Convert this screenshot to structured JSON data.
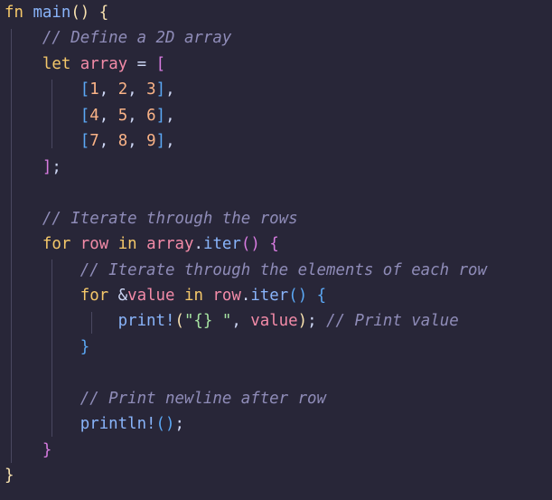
{
  "editor": {
    "theme_colors": {
      "background": "#282638",
      "keyword": "#f5c86a",
      "function": "#89b4fa",
      "variable": "#f38ba8",
      "comment": "#8f8cb8",
      "number": "#fab387",
      "string": "#a6e3a1"
    },
    "lines": [
      {
        "tokens": [
          [
            "kw",
            "fn"
          ],
          [
            "op",
            " "
          ],
          [
            "fn",
            "main"
          ],
          [
            "b1",
            "()"
          ],
          [
            "op",
            " "
          ],
          [
            "b1",
            "{"
          ]
        ]
      },
      {
        "tokens": [
          [
            "op",
            "    "
          ],
          [
            "cm",
            "// Define a 2D array"
          ]
        ]
      },
      {
        "tokens": [
          [
            "op",
            "    "
          ],
          [
            "kw",
            "let"
          ],
          [
            "op",
            " "
          ],
          [
            "var",
            "array"
          ],
          [
            "op",
            " = "
          ],
          [
            "b2",
            "["
          ]
        ]
      },
      {
        "tokens": [
          [
            "op",
            "        "
          ],
          [
            "b3",
            "["
          ],
          [
            "num",
            "1"
          ],
          [
            "punct",
            ", "
          ],
          [
            "num",
            "2"
          ],
          [
            "punct",
            ", "
          ],
          [
            "num",
            "3"
          ],
          [
            "b3",
            "]"
          ],
          [
            "punct",
            ","
          ]
        ]
      },
      {
        "tokens": [
          [
            "op",
            "        "
          ],
          [
            "b3",
            "["
          ],
          [
            "num",
            "4"
          ],
          [
            "punct",
            ", "
          ],
          [
            "num",
            "5"
          ],
          [
            "punct",
            ", "
          ],
          [
            "num",
            "6"
          ],
          [
            "b3",
            "]"
          ],
          [
            "punct",
            ","
          ]
        ]
      },
      {
        "tokens": [
          [
            "op",
            "        "
          ],
          [
            "b3",
            "["
          ],
          [
            "num",
            "7"
          ],
          [
            "punct",
            ", "
          ],
          [
            "num",
            "8"
          ],
          [
            "punct",
            ", "
          ],
          [
            "num",
            "9"
          ],
          [
            "b3",
            "]"
          ],
          [
            "punct",
            ","
          ]
        ]
      },
      {
        "tokens": [
          [
            "op",
            "    "
          ],
          [
            "b2",
            "]"
          ],
          [
            "punct",
            ";"
          ]
        ]
      },
      {
        "tokens": []
      },
      {
        "tokens": [
          [
            "op",
            "    "
          ],
          [
            "cm",
            "// Iterate through the rows"
          ]
        ]
      },
      {
        "tokens": [
          [
            "op",
            "    "
          ],
          [
            "kw",
            "for"
          ],
          [
            "op",
            " "
          ],
          [
            "var",
            "row"
          ],
          [
            "op",
            " "
          ],
          [
            "kw",
            "in"
          ],
          [
            "op",
            " "
          ],
          [
            "var",
            "array"
          ],
          [
            "punct",
            "."
          ],
          [
            "fn",
            "iter"
          ],
          [
            "b2",
            "()"
          ],
          [
            "op",
            " "
          ],
          [
            "b2",
            "{"
          ]
        ]
      },
      {
        "tokens": [
          [
            "op",
            "        "
          ],
          [
            "cm",
            "// Iterate through the elements of each row"
          ]
        ]
      },
      {
        "tokens": [
          [
            "op",
            "        "
          ],
          [
            "kw",
            "for"
          ],
          [
            "op",
            " &"
          ],
          [
            "var",
            "value"
          ],
          [
            "op",
            " "
          ],
          [
            "kw",
            "in"
          ],
          [
            "op",
            " "
          ],
          [
            "var",
            "row"
          ],
          [
            "punct",
            "."
          ],
          [
            "fn",
            "iter"
          ],
          [
            "b3",
            "()"
          ],
          [
            "op",
            " "
          ],
          [
            "b3",
            "{"
          ]
        ]
      },
      {
        "tokens": [
          [
            "op",
            "            "
          ],
          [
            "mac",
            "print!"
          ],
          [
            "b1",
            "("
          ],
          [
            "str",
            "\"{} \""
          ],
          [
            "punct",
            ", "
          ],
          [
            "var",
            "value"
          ],
          [
            "b1",
            ")"
          ],
          [
            "punct",
            ";"
          ],
          [
            "op",
            " "
          ],
          [
            "cm",
            "// Print value"
          ]
        ]
      },
      {
        "tokens": [
          [
            "op",
            "        "
          ],
          [
            "b3",
            "}"
          ]
        ]
      },
      {
        "tokens": []
      },
      {
        "tokens": [
          [
            "op",
            "        "
          ],
          [
            "cm",
            "// Print newline after row"
          ]
        ]
      },
      {
        "tokens": [
          [
            "op",
            "        "
          ],
          [
            "mac",
            "println!"
          ],
          [
            "b3",
            "()"
          ],
          [
            "punct",
            ";"
          ]
        ]
      },
      {
        "tokens": [
          [
            "op",
            "    "
          ],
          [
            "b2",
            "}"
          ]
        ]
      },
      {
        "tokens": [
          [
            "b1",
            "}"
          ]
        ]
      }
    ]
  }
}
